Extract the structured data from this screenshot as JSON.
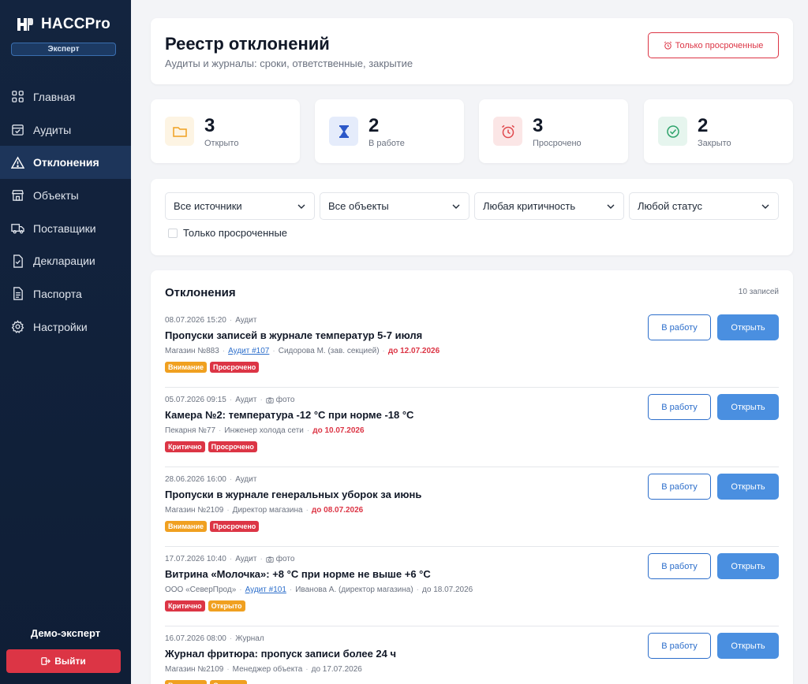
{
  "app": {
    "name": "HACCPro",
    "plan": "Эксперт"
  },
  "sidebar": {
    "items": [
      {
        "label": "Главная",
        "icon": "grid-icon",
        "active": false
      },
      {
        "label": "Аудиты",
        "icon": "calendar-check-icon",
        "active": false
      },
      {
        "label": "Отклонения",
        "icon": "warning-triangle-icon",
        "active": true
      },
      {
        "label": "Объекты",
        "icon": "store-icon",
        "active": false
      },
      {
        "label": "Поставщики",
        "icon": "truck-icon",
        "active": false
      },
      {
        "label": "Декларации",
        "icon": "document-check-icon",
        "active": false
      },
      {
        "label": "Паспорта",
        "icon": "document-text-icon",
        "active": false
      },
      {
        "label": "Настройки",
        "icon": "gear-icon",
        "active": false
      }
    ],
    "user": "Демо-эксперт",
    "logout_label": "Выйти"
  },
  "header": {
    "title": "Реестр отклонений",
    "subtitle": "Аудиты и журналы: сроки, ответственные, закрытие",
    "overdue_button": "Только просроченные"
  },
  "stats": [
    {
      "value": "3",
      "label": "Открыто",
      "icon": "folder-icon",
      "color": "#f5b335",
      "bg": "#fdf4e3"
    },
    {
      "value": "2",
      "label": "В работе",
      "icon": "hourglass-icon",
      "color": "#2c58c8",
      "bg": "#e5ecfb"
    },
    {
      "value": "3",
      "label": "Просрочено",
      "icon": "alarm-clock-icon",
      "color": "#e0474c",
      "bg": "#fbe6e6"
    },
    {
      "value": "2",
      "label": "Закрыто",
      "icon": "check-circle-icon",
      "color": "#2ea36b",
      "bg": "#e6f5ee"
    }
  ],
  "filters": {
    "source": "Все источники",
    "object": "Все объекты",
    "criticality": "Любая критичность",
    "status": "Любой статус",
    "only_overdue": "Только просроченные"
  },
  "list": {
    "title": "Отклонения",
    "count": "10 записей",
    "work_button": "В работу",
    "open_button": "Открыть",
    "photo_label": "фото",
    "items": [
      {
        "datetime": "08.07.2026 15:20",
        "source": "Аудит",
        "has_photo": false,
        "title": "Пропуски записей в журнале температур 5-7 июля",
        "object": "Магазин №883",
        "audit": "Аудит #107",
        "person": "Сидорова М. (зав. секцией)",
        "due": "до 12.07.2026",
        "due_overdue": true,
        "tags": [
          {
            "label": "Внимание",
            "color": "#f0a020"
          },
          {
            "label": "Просрочено",
            "color": "#dc3545"
          }
        ]
      },
      {
        "datetime": "05.07.2026 09:15",
        "source": "Аудит",
        "has_photo": true,
        "title": "Камера №2: температура -12 °C при норме -18 °C",
        "object": "Пекарня №77",
        "audit": "",
        "person": "Инженер холода сети",
        "due": "до 10.07.2026",
        "due_overdue": true,
        "tags": [
          {
            "label": "Критично",
            "color": "#dc3545"
          },
          {
            "label": "Просрочено",
            "color": "#dc3545"
          }
        ]
      },
      {
        "datetime": "28.06.2026 16:00",
        "source": "Аудит",
        "has_photo": false,
        "title": "Пропуски в журнале генеральных уборок за июнь",
        "object": "Магазин №2109",
        "audit": "",
        "person": "Директор магазина",
        "due": "до 08.07.2026",
        "due_overdue": true,
        "tags": [
          {
            "label": "Внимание",
            "color": "#f0a020"
          },
          {
            "label": "Просрочено",
            "color": "#dc3545"
          }
        ]
      },
      {
        "datetime": "17.07.2026 10:40",
        "source": "Аудит",
        "has_photo": true,
        "title": "Витрина «Молочка»: +8 °C при норме не выше +6 °C",
        "object": "ООО «СеверПрод»",
        "audit": "Аудит #101",
        "person": "Иванова А. (директор магазина)",
        "due": "до 18.07.2026",
        "due_overdue": false,
        "tags": [
          {
            "label": "Критично",
            "color": "#dc3545"
          },
          {
            "label": "Открыто",
            "color": "#f0a020"
          }
        ]
      },
      {
        "datetime": "16.07.2026 08:00",
        "source": "Журнал",
        "has_photo": false,
        "title": "Журнал фритюра: пропуск записи более 24 ч",
        "object": "Магазин №2109",
        "audit": "",
        "person": "Менеджер объекта",
        "due": "до 17.07.2026",
        "due_overdue": false,
        "tags": [
          {
            "label": "Внимание",
            "color": "#f0a020"
          },
          {
            "label": "Открыто",
            "color": "#f0a020"
          }
        ]
      }
    ]
  }
}
